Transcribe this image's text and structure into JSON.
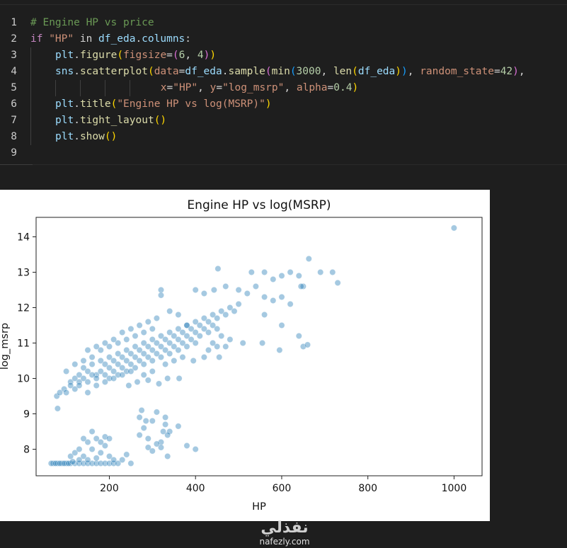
{
  "editor": {
    "lines": [
      {
        "n": "1",
        "indent": 0,
        "tokens": [
          [
            "c-comment",
            "# Engine HP vs price"
          ]
        ]
      },
      {
        "n": "2",
        "indent": 0,
        "tokens": [
          [
            "c-kw",
            "if "
          ],
          [
            "c-str",
            "\"HP\""
          ],
          [
            "c-op",
            " in "
          ],
          [
            "c-id",
            "df_eda"
          ],
          [
            "c-op",
            "."
          ],
          [
            "c-id",
            "columns"
          ],
          [
            "c-op",
            ":"
          ]
        ]
      },
      {
        "n": "3",
        "indent": 1,
        "tokens": [
          [
            "c-id",
            "plt"
          ],
          [
            "c-op",
            "."
          ],
          [
            "c-fn",
            "figure"
          ],
          [
            "c-p1",
            "("
          ],
          [
            "c-kwarg",
            "figsize"
          ],
          [
            "c-op",
            "="
          ],
          [
            "c-p2",
            "("
          ],
          [
            "c-num",
            "6"
          ],
          [
            "c-op",
            ", "
          ],
          [
            "c-num",
            "4"
          ],
          [
            "c-p2",
            ")"
          ],
          [
            "c-p1",
            ")"
          ]
        ]
      },
      {
        "n": "4",
        "indent": 1,
        "tokens": [
          [
            "c-id",
            "sns"
          ],
          [
            "c-op",
            "."
          ],
          [
            "c-fn",
            "scatterplot"
          ],
          [
            "c-p1",
            "("
          ],
          [
            "c-kwarg",
            "data"
          ],
          [
            "c-op",
            "="
          ],
          [
            "c-id",
            "df_eda"
          ],
          [
            "c-op",
            "."
          ],
          [
            "c-fn",
            "sample"
          ],
          [
            "c-p2",
            "("
          ],
          [
            "c-fn",
            "min"
          ],
          [
            "c-p3",
            "("
          ],
          [
            "c-num",
            "3000"
          ],
          [
            "c-op",
            ", "
          ],
          [
            "c-fn",
            "len"
          ],
          [
            "c-p1",
            "("
          ],
          [
            "c-id",
            "df_eda"
          ],
          [
            "c-p1",
            ")"
          ],
          [
            "c-p3",
            ")"
          ],
          [
            "c-op",
            ", "
          ],
          [
            "c-kwarg",
            "random_state"
          ],
          [
            "c-op",
            "="
          ],
          [
            "c-num",
            "42"
          ],
          [
            "c-p2",
            ")"
          ],
          [
            "c-op",
            ","
          ]
        ]
      },
      {
        "n": "5",
        "indent": 5,
        "pad": "                ",
        "tokens": [
          [
            "c-kwarg",
            "x"
          ],
          [
            "c-op",
            "="
          ],
          [
            "c-str",
            "\"HP\""
          ],
          [
            "c-op",
            ", "
          ],
          [
            "c-kwarg",
            "y"
          ],
          [
            "c-op",
            "="
          ],
          [
            "c-str",
            "\"log_msrp\""
          ],
          [
            "c-op",
            ", "
          ],
          [
            "c-kwarg",
            "alpha"
          ],
          [
            "c-op",
            "="
          ],
          [
            "c-num",
            "0.4"
          ],
          [
            "c-p1",
            ")"
          ]
        ]
      },
      {
        "n": "6",
        "indent": 1,
        "tokens": [
          [
            "c-id",
            "plt"
          ],
          [
            "c-op",
            "."
          ],
          [
            "c-fn",
            "title"
          ],
          [
            "c-p1",
            "("
          ],
          [
            "c-str",
            "\"Engine HP vs log(MSRP)\""
          ],
          [
            "c-p1",
            ")"
          ]
        ]
      },
      {
        "n": "7",
        "indent": 1,
        "tokens": [
          [
            "c-id",
            "plt"
          ],
          [
            "c-op",
            "."
          ],
          [
            "c-fn",
            "tight_layout"
          ],
          [
            "c-p1",
            "()"
          ]
        ]
      },
      {
        "n": "8",
        "indent": 1,
        "tokens": [
          [
            "c-id",
            "plt"
          ],
          [
            "c-op",
            "."
          ],
          [
            "c-fn",
            "show"
          ],
          [
            "c-p1",
            "()"
          ]
        ]
      },
      {
        "n": "9",
        "indent": 0,
        "tokens": []
      }
    ]
  },
  "chart_data": {
    "type": "scatter",
    "title": "Engine HP vs log(MSRP)",
    "xlabel": "HP",
    "ylabel": "log_msrp",
    "xlim": [
      30,
      1065
    ],
    "ylim": [
      7.25,
      14.55
    ],
    "xticks": [
      200,
      400,
      600,
      800,
      1000
    ],
    "yticks": [
      8,
      9,
      10,
      11,
      12,
      13,
      14
    ],
    "xtick_labels": [
      "200",
      "400",
      "600",
      "800",
      "1000"
    ],
    "ytick_labels": [
      "8",
      "9",
      "10",
      "11",
      "12",
      "13",
      "14"
    ],
    "grid": false,
    "point_color": "#1f77b4",
    "alpha": 0.4,
    "points": [
      [
        1000,
        14.25
      ],
      [
        663,
        13.38
      ],
      [
        690,
        13.0
      ],
      [
        718,
        13.0
      ],
      [
        730,
        12.7
      ],
      [
        452,
        13.1
      ],
      [
        530,
        13.0
      ],
      [
        560,
        13.0
      ],
      [
        580,
        12.8
      ],
      [
        600,
        12.9
      ],
      [
        620,
        13.0
      ],
      [
        650,
        12.6
      ],
      [
        640,
        12.9
      ],
      [
        645,
        12.6
      ],
      [
        320,
        12.5
      ],
      [
        320,
        12.35
      ],
      [
        400,
        12.5
      ],
      [
        420,
        12.4
      ],
      [
        443,
        12.5
      ],
      [
        470,
        12.6
      ],
      [
        500,
        12.5
      ],
      [
        520,
        12.4
      ],
      [
        540,
        12.6
      ],
      [
        560,
        12.3
      ],
      [
        580,
        12.2
      ],
      [
        600,
        12.3
      ],
      [
        620,
        12.1
      ],
      [
        560,
        11.8
      ],
      [
        600,
        11.5
      ],
      [
        640,
        11.2
      ],
      [
        650,
        10.9
      ],
      [
        660,
        10.95
      ],
      [
        595,
        10.8
      ],
      [
        555,
        11.0
      ],
      [
        510,
        11.0
      ],
      [
        480,
        11.1
      ],
      [
        450,
        10.9
      ],
      [
        380,
        11.5
      ],
      [
        360,
        11.8
      ],
      [
        340,
        11.9
      ],
      [
        80,
        9.15
      ],
      [
        78,
        9.5
      ],
      [
        85,
        9.6
      ],
      [
        95,
        9.7
      ],
      [
        100,
        10.2
      ],
      [
        110,
        9.9
      ],
      [
        120,
        10.0
      ],
      [
        130,
        10.1
      ],
      [
        140,
        10.3
      ],
      [
        150,
        10.2
      ],
      [
        160,
        10.4
      ],
      [
        170,
        10.1
      ],
      [
        180,
        10.5
      ],
      [
        190,
        10.4
      ],
      [
        200,
        10.6
      ],
      [
        210,
        10.5
      ],
      [
        220,
        10.7
      ],
      [
        230,
        10.6
      ],
      [
        240,
        10.8
      ],
      [
        250,
        10.7
      ],
      [
        260,
        10.9
      ],
      [
        270,
        10.8
      ],
      [
        280,
        11.0
      ],
      [
        290,
        10.9
      ],
      [
        300,
        11.1
      ],
      [
        310,
        11.0
      ],
      [
        320,
        11.2
      ],
      [
        330,
        11.1
      ],
      [
        340,
        11.3
      ],
      [
        350,
        11.2
      ],
      [
        360,
        11.4
      ],
      [
        370,
        11.3
      ],
      [
        380,
        11.5
      ],
      [
        390,
        11.4
      ],
      [
        400,
        11.6
      ],
      [
        410,
        11.5
      ],
      [
        420,
        11.7
      ],
      [
        430,
        11.6
      ],
      [
        440,
        11.8
      ],
      [
        450,
        11.7
      ],
      [
        460,
        11.9
      ],
      [
        470,
        11.8
      ],
      [
        480,
        12.0
      ],
      [
        490,
        11.9
      ],
      [
        500,
        12.1
      ],
      [
        100,
        9.6
      ],
      [
        110,
        9.8
      ],
      [
        120,
        9.7
      ],
      [
        130,
        9.9
      ],
      [
        140,
        10.0
      ],
      [
        150,
        9.9
      ],
      [
        160,
        10.1
      ],
      [
        170,
        10.0
      ],
      [
        180,
        10.2
      ],
      [
        190,
        10.1
      ],
      [
        200,
        10.3
      ],
      [
        210,
        10.2
      ],
      [
        220,
        10.4
      ],
      [
        230,
        10.3
      ],
      [
        240,
        10.5
      ],
      [
        250,
        10.4
      ],
      [
        260,
        10.6
      ],
      [
        270,
        10.5
      ],
      [
        280,
        10.7
      ],
      [
        290,
        10.6
      ],
      [
        300,
        10.8
      ],
      [
        310,
        10.7
      ],
      [
        320,
        10.9
      ],
      [
        330,
        10.8
      ],
      [
        340,
        11.0
      ],
      [
        350,
        10.9
      ],
      [
        360,
        11.1
      ],
      [
        370,
        11.0
      ],
      [
        380,
        11.2
      ],
      [
        390,
        11.1
      ],
      [
        400,
        11.3
      ],
      [
        410,
        11.2
      ],
      [
        420,
        11.4
      ],
      [
        430,
        11.3
      ],
      [
        440,
        11.5
      ],
      [
        450,
        11.4
      ],
      [
        120,
        10.4
      ],
      [
        140,
        10.5
      ],
      [
        160,
        10.6
      ],
      [
        180,
        10.8
      ],
      [
        200,
        10.9
      ],
      [
        220,
        11.0
      ],
      [
        240,
        11.1
      ],
      [
        260,
        11.2
      ],
      [
        280,
        11.3
      ],
      [
        300,
        11.4
      ],
      [
        150,
        10.8
      ],
      [
        170,
        10.9
      ],
      [
        190,
        11.0
      ],
      [
        210,
        11.1
      ],
      [
        230,
        11.3
      ],
      [
        250,
        11.4
      ],
      [
        270,
        11.5
      ],
      [
        290,
        11.6
      ],
      [
        310,
        11.7
      ],
      [
        200,
        10.0
      ],
      [
        220,
        10.1
      ],
      [
        240,
        10.2
      ],
      [
        260,
        10.3
      ],
      [
        280,
        10.4
      ],
      [
        300,
        10.5
      ],
      [
        320,
        10.6
      ],
      [
        340,
        10.7
      ],
      [
        360,
        10.8
      ],
      [
        380,
        10.9
      ],
      [
        400,
        11.0
      ],
      [
        130,
        9.8
      ],
      [
        150,
        9.6
      ],
      [
        170,
        9.8
      ],
      [
        190,
        9.9
      ],
      [
        210,
        10.0
      ],
      [
        230,
        10.1
      ],
      [
        250,
        10.2
      ],
      [
        330,
        10.4
      ],
      [
        350,
        10.5
      ],
      [
        370,
        10.6
      ],
      [
        300,
        10.2
      ],
      [
        280,
        10.1
      ],
      [
        440,
        11.0
      ],
      [
        460,
        11.2
      ],
      [
        430,
        10.8
      ],
      [
        470,
        10.9
      ],
      [
        455,
        10.6
      ],
      [
        420,
        10.6
      ],
      [
        395,
        10.5
      ],
      [
        362,
        10.0
      ],
      [
        335,
        10.0
      ],
      [
        315,
        9.85
      ],
      [
        290,
        9.95
      ],
      [
        265,
        9.9
      ],
      [
        245,
        9.8
      ],
      [
        70,
        7.6
      ],
      [
        80,
        7.6
      ],
      [
        90,
        7.6
      ],
      [
        100,
        7.6
      ],
      [
        110,
        7.6
      ],
      [
        120,
        7.6
      ],
      [
        130,
        7.6
      ],
      [
        140,
        7.6
      ],
      [
        150,
        7.6
      ],
      [
        160,
        7.6
      ],
      [
        170,
        7.6
      ],
      [
        180,
        7.6
      ],
      [
        190,
        7.6
      ],
      [
        200,
        7.6
      ],
      [
        210,
        7.6
      ],
      [
        65,
        7.6
      ],
      [
        75,
        7.6
      ],
      [
        85,
        7.6
      ],
      [
        95,
        7.6
      ],
      [
        105,
        7.6
      ],
      [
        110,
        7.8
      ],
      [
        120,
        7.9
      ],
      [
        130,
        8.0
      ],
      [
        140,
        7.8
      ],
      [
        150,
        8.2
      ],
      [
        160,
        8.0
      ],
      [
        170,
        8.3
      ],
      [
        180,
        7.9
      ],
      [
        190,
        8.1
      ],
      [
        200,
        7.8
      ],
      [
        210,
        7.7
      ],
      [
        220,
        7.6
      ],
      [
        230,
        7.7
      ],
      [
        240,
        7.85
      ],
      [
        250,
        7.6
      ],
      [
        140,
        8.3
      ],
      [
        160,
        8.5
      ],
      [
        180,
        8.2
      ],
      [
        190,
        8.35
      ],
      [
        150,
        7.7
      ],
      [
        170,
        7.75
      ],
      [
        130,
        7.7
      ],
      [
        115,
        7.65
      ],
      [
        200,
        8.3
      ],
      [
        270,
        8.4
      ],
      [
        280,
        8.6
      ],
      [
        290,
        8.3
      ],
      [
        300,
        8.8
      ],
      [
        310,
        9.05
      ],
      [
        320,
        8.2
      ],
      [
        330,
        8.7
      ],
      [
        340,
        8.5
      ],
      [
        270,
        8.9
      ],
      [
        285,
        8.8
      ],
      [
        325,
        8.5
      ],
      [
        330,
        8.9
      ],
      [
        335,
        8.4
      ],
      [
        360,
        8.65
      ],
      [
        380,
        8.1
      ],
      [
        400,
        8.0
      ],
      [
        335,
        7.8
      ],
      [
        320,
        8.05
      ],
      [
        310,
        8.15
      ],
      [
        275,
        9.1
      ],
      [
        290,
        8.05
      ],
      [
        300,
        7.95
      ]
    ]
  },
  "watermark": {
    "logo": "نفذلي",
    "url": "nafezly.com"
  }
}
